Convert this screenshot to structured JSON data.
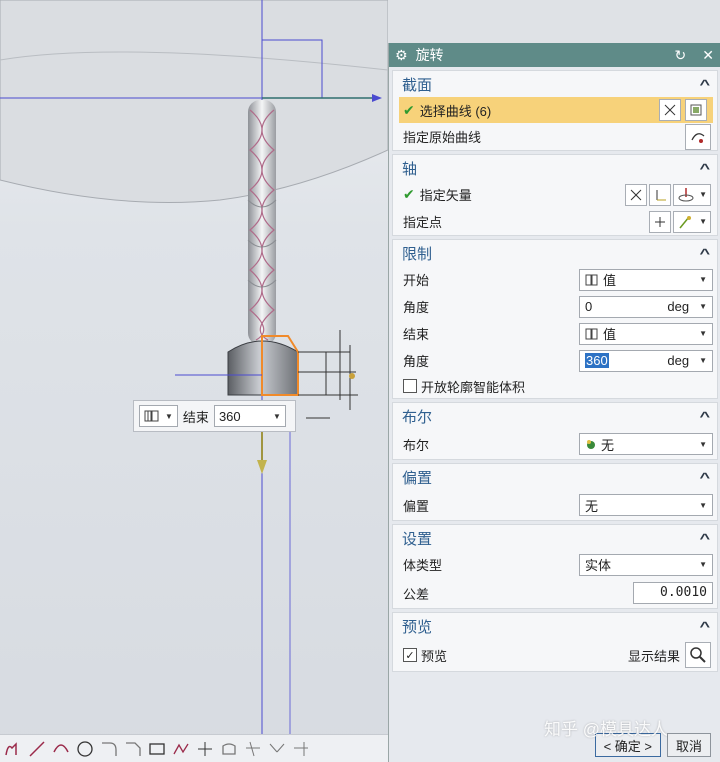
{
  "dialog": {
    "title": "旋转",
    "sections": {
      "section": {
        "heading": "截面",
        "select_curve_label": "选择曲线 (6)",
        "specify_origin_curve_label": "指定原始曲线"
      },
      "axis": {
        "heading": "轴",
        "specify_vector_label": "指定矢量",
        "specify_point_label": "指定点"
      },
      "limits": {
        "heading": "限制",
        "start_label": "开始",
        "start_value": "值",
        "start_angle_label": "角度",
        "start_angle_value": "0",
        "end_label": "结束",
        "end_value": "值",
        "end_angle_label": "角度",
        "end_angle_value": "360",
        "unit": "deg",
        "open_profile_label": "开放轮廓智能体积"
      },
      "boolean": {
        "heading": "布尔",
        "label": "布尔",
        "value": "无"
      },
      "offset": {
        "heading": "偏置",
        "label": "偏置",
        "value": "无"
      },
      "settings": {
        "heading": "设置",
        "body_type_label": "体类型",
        "body_type_value": "实体",
        "tolerance_label": "公差",
        "tolerance_value": "0.0010"
      },
      "preview": {
        "heading": "预览",
        "preview_label": "预览",
        "show_result_label": "显示结果"
      }
    },
    "ok_label": "< 确定 >",
    "cancel_label": "取消"
  },
  "floating_input": {
    "label": "结束",
    "value": "360"
  },
  "watermark": "知乎 @模具达人",
  "colors": {
    "titlebar": "#5f8b88",
    "section_heading": "#2f5f8f",
    "selection_highlight": "#f7d27a",
    "axis_line": "#3c3cc8"
  }
}
